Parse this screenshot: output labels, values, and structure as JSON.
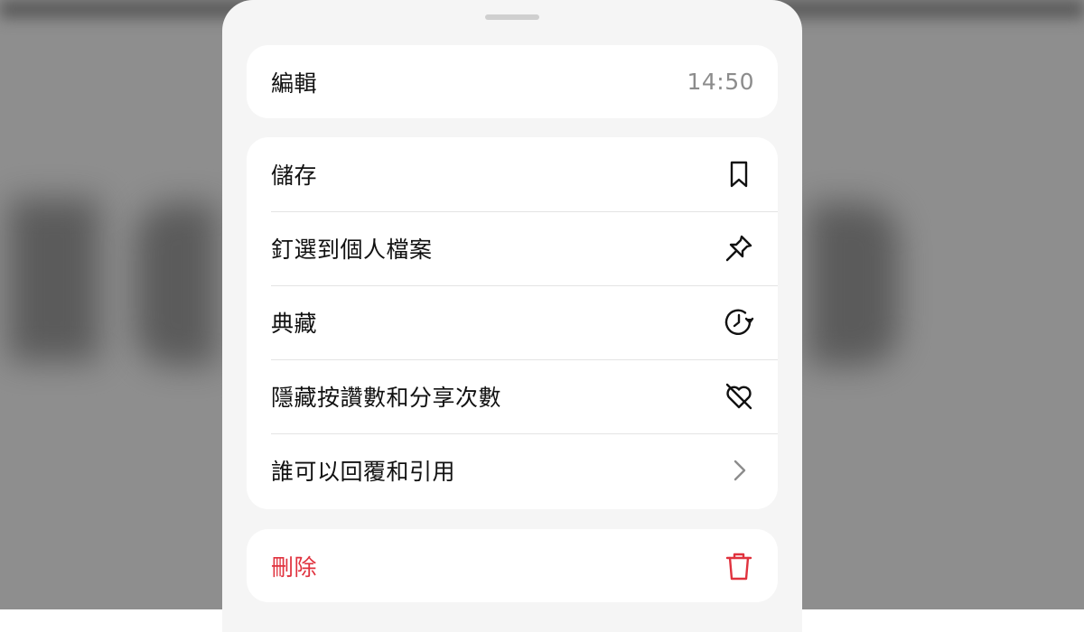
{
  "sheet": {
    "edit": {
      "label": "編輯",
      "time": "14:50"
    },
    "menu_items": [
      {
        "label": "儲存",
        "icon": "bookmark-icon"
      },
      {
        "label": "釘選到個人檔案",
        "icon": "pin-icon"
      },
      {
        "label": "典藏",
        "icon": "archive-clock-icon"
      },
      {
        "label": "隱藏按讚數和分享次數",
        "icon": "heart-off-icon"
      },
      {
        "label": "誰可以回覆和引用",
        "icon": "chevron-right-icon"
      }
    ],
    "delete": {
      "label": "刪除",
      "icon": "trash-icon"
    }
  },
  "colors": {
    "danger": "#e0323e",
    "sheet_background": "#f5f5f5",
    "card_background": "#ffffff",
    "secondary_text": "#8c8c8c"
  }
}
